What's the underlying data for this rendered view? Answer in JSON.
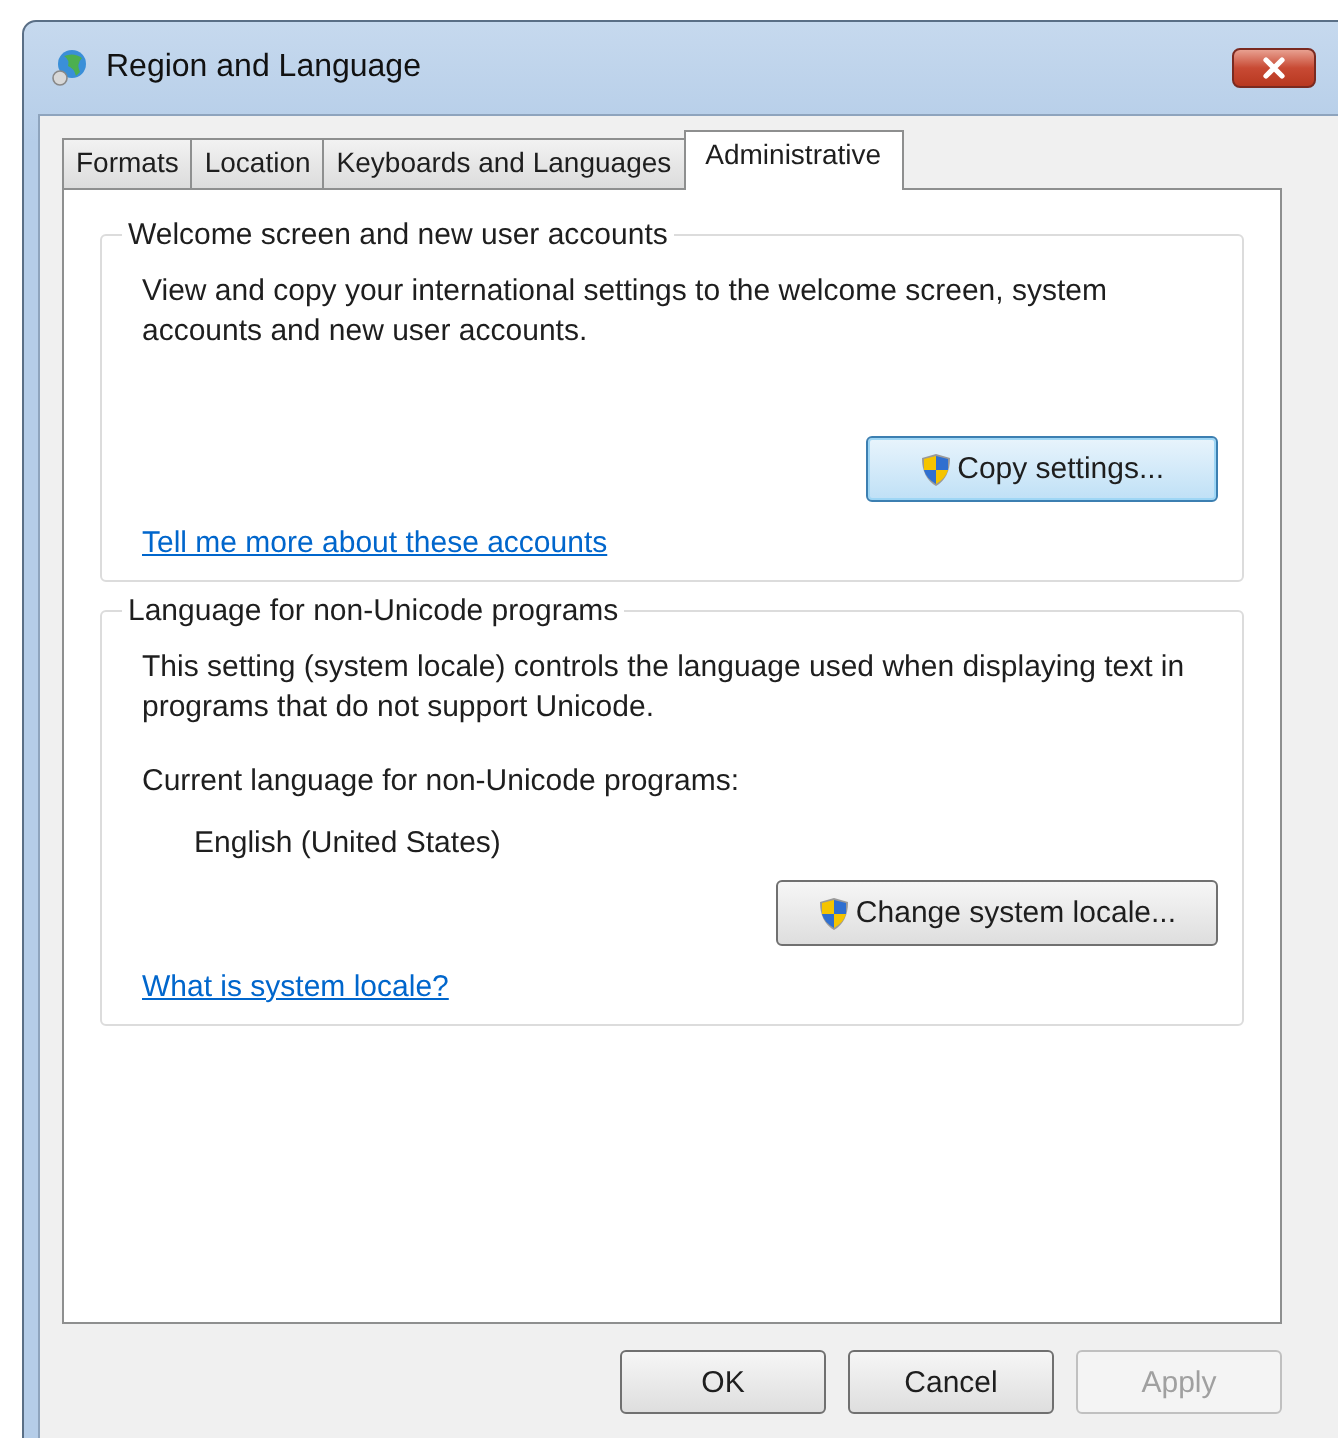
{
  "window": {
    "title": "Region and Language"
  },
  "tabs": [
    {
      "label": "Formats",
      "selected": false
    },
    {
      "label": "Location",
      "selected": false
    },
    {
      "label": "Keyboards and Languages",
      "selected": false
    },
    {
      "label": "Administrative",
      "selected": true
    }
  ],
  "groups": [
    {
      "title": "Welcome screen and new user accounts",
      "description": "View and copy your international settings to the welcome screen, system accounts and new user accounts.",
      "button": {
        "label": "Copy settings...",
        "highlighted": true
      },
      "link": "Tell me more about these accounts"
    },
    {
      "title": "Language for non-Unicode programs",
      "description": "This setting (system locale) controls the language used when displaying text in programs that do not support Unicode.",
      "current_label": "Current language for non-Unicode programs:",
      "current_value": "English (United States)",
      "button": {
        "label": "Change system locale...",
        "highlighted": false
      },
      "link": "What is system locale?"
    }
  ],
  "buttons": [
    {
      "label": "OK",
      "disabled": false
    },
    {
      "label": "Cancel",
      "disabled": false
    },
    {
      "label": "Apply",
      "disabled": true
    }
  ]
}
